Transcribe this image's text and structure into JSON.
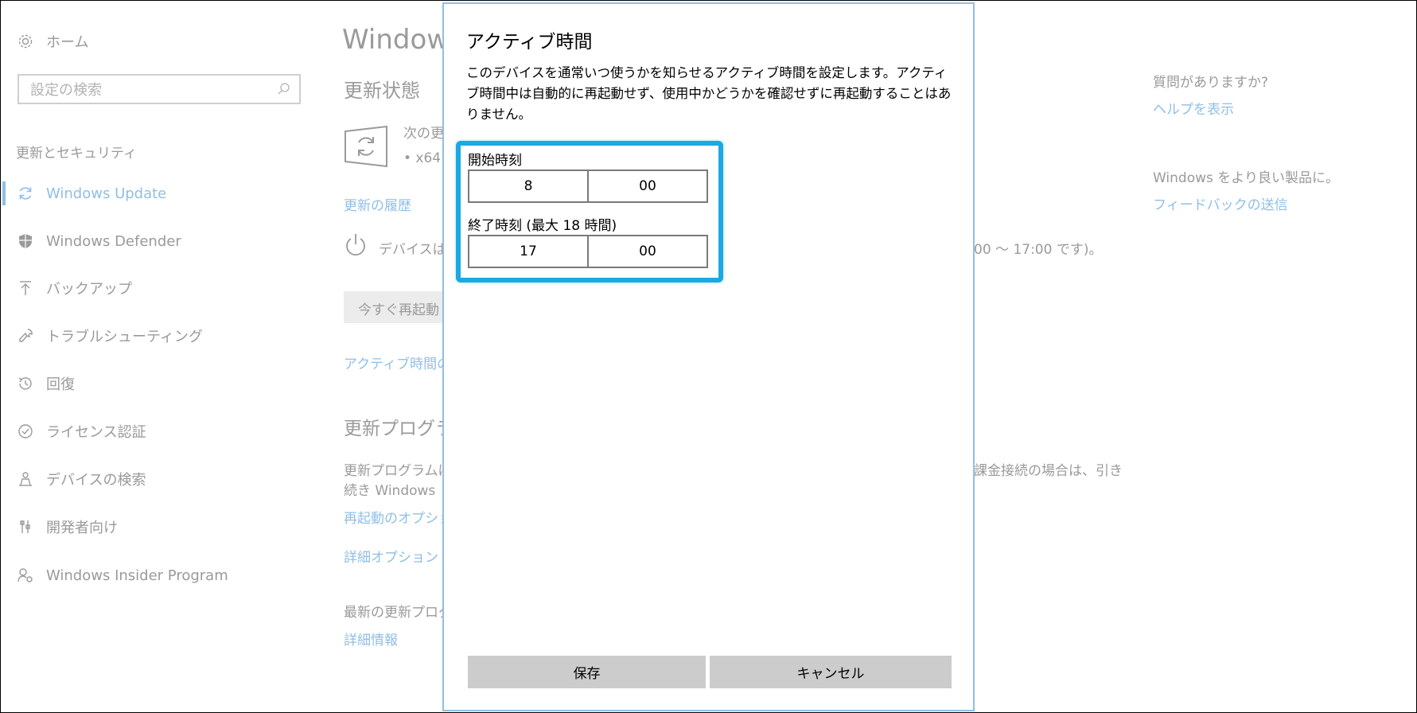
{
  "sidebar": {
    "home_label": "ホーム",
    "search_placeholder": "設定の検索",
    "section_title": "更新とセキュリティ",
    "items": [
      {
        "label": "Windows Update",
        "icon": "refresh-icon",
        "active": true
      },
      {
        "label": "Windows Defender",
        "icon": "shield-icon"
      },
      {
        "label": "バックアップ",
        "icon": "upload-arrow-icon"
      },
      {
        "label": "トラブルシューティング",
        "icon": "wrench-icon"
      },
      {
        "label": "回復",
        "icon": "history-icon"
      },
      {
        "label": "ライセンス認証",
        "icon": "check-circle-icon"
      },
      {
        "label": "デバイスの検索",
        "icon": "person-location-icon"
      },
      {
        "label": "開発者向け",
        "icon": "developer-tools-icon"
      },
      {
        "label": "Windows Insider Program",
        "icon": "insider-person-icon"
      }
    ]
  },
  "main": {
    "page_title": "Window",
    "status_heading": "更新状態",
    "next_update_partial": "次の更",
    "x64_partial": "• x64",
    "history_link": "更新の履歴",
    "device_partial": "デバイスは",
    "active_hours_tail": "00 ～ 17:00 です)。",
    "restart_button": "今すぐ再起動",
    "active_hours_link": "アクティブ時間の",
    "update_settings_heading": "更新プログラ",
    "update_text_line1": "更新プログラムは",
    "update_text_line1_tail": "課金接続の場合は、引き",
    "update_text_line2": "続き Windows",
    "restart_options_link": "再起動のオプショ",
    "advanced_options_link": "詳細オプション",
    "latest_updates_partial": "最新の更新プログ",
    "more_info_link": "詳細情報"
  },
  "right": {
    "question": "質問がありますか?",
    "help_link": "ヘルプを表示",
    "improve": "Windows をより良い製品に。",
    "feedback_link": "フィードバックの送信"
  },
  "dialog": {
    "title": "アクティブ時間",
    "description": "このデバイスを通常いつ使うかを知らせるアクティブ時間を設定します。アクティブ時間中は自動的に再起動せず、使用中かどうかを確認せずに再起動することはありません。",
    "start_label": "開始時刻",
    "start_hour": "8",
    "start_minute": "00",
    "end_label": "終了時刻 (最大 18 時間)",
    "end_hour": "17",
    "end_minute": "00",
    "save_button": "保存",
    "cancel_button": "キャンセル"
  },
  "colors": {
    "accent_link": "#8fbfe6",
    "highlight": "#1aa9e0",
    "button_bg": "#cccccc",
    "muted_text": "#9a9a9a"
  }
}
